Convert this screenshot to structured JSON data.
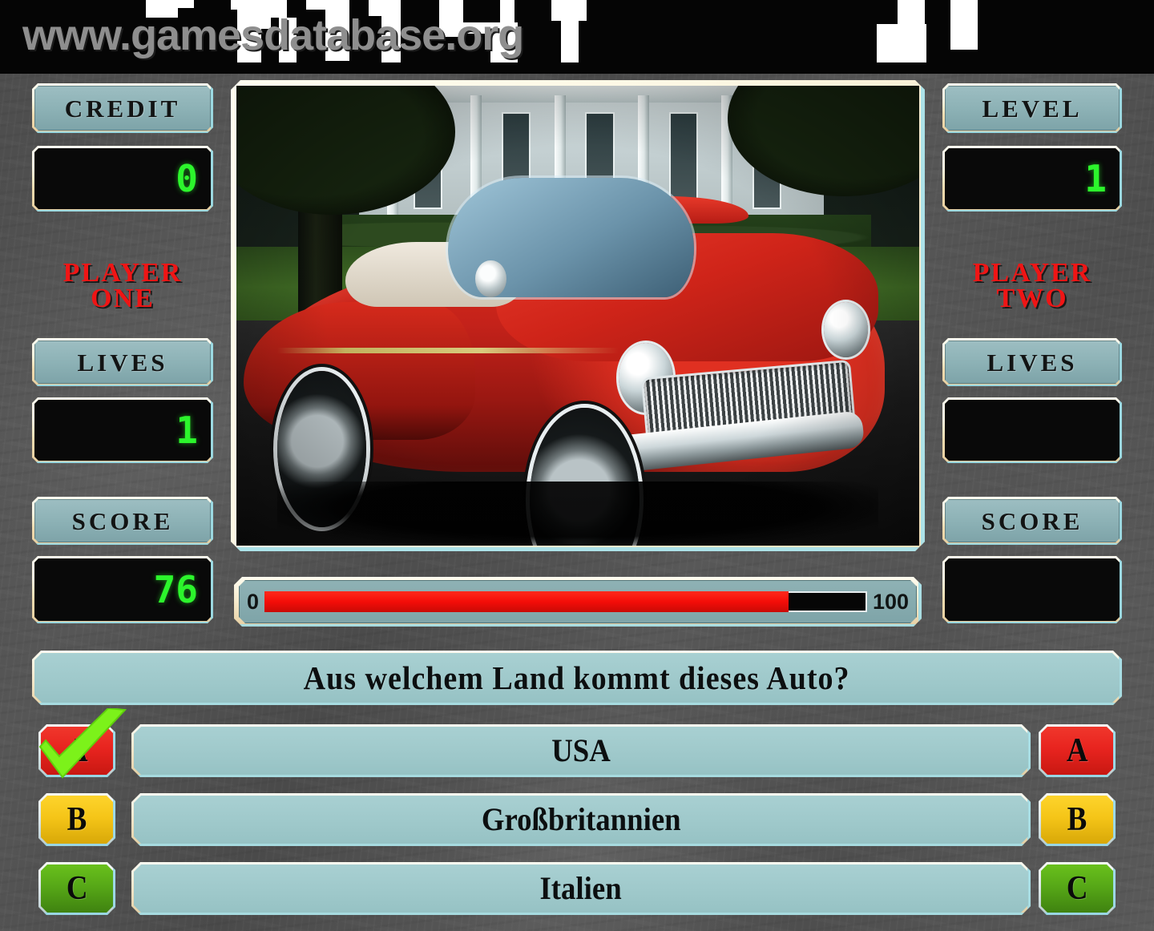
{
  "watermark": {
    "text": "www.gamesdatabase.org"
  },
  "colors": {
    "accent_red": "#ef1515",
    "lcd_green": "#2cf52c",
    "panel_teal": "#a8d0d2",
    "bevel_cream": "#fffdf0",
    "bevel_cyan": "#a8e0e9",
    "key_a": "#e8241f",
    "key_b": "#f5c518",
    "key_c": "#57a817",
    "timer_red": "#f40d08",
    "check_green": "#7cf21a",
    "background_gray": "#505050"
  },
  "left_panel": {
    "credit_label": "CREDIT",
    "credit_value": "0",
    "player_name_line1": "PLAYER",
    "player_name_line2": "ONE",
    "lives_label": "LIVES",
    "lives_value": "1",
    "score_label": "SCORE",
    "score_value": "76"
  },
  "right_panel": {
    "level_label": "LEVEL",
    "level_value": "1",
    "player_name_line1": "PLAYER",
    "player_name_line2": "TWO",
    "lives_label": "LIVES",
    "lives_value": "",
    "score_label": "SCORE",
    "score_value": ""
  },
  "photo": {
    "description": "red 1950s American convertible car parked on driveway in front of white house"
  },
  "timer": {
    "min_label": "0",
    "max_label": "100",
    "value": 87,
    "fill_percent": "87%"
  },
  "question": {
    "text": "Aus welchem Land kommt dieses Auto?"
  },
  "answers": [
    {
      "key": "A",
      "text": "USA",
      "color": "#e8241f",
      "correct": true
    },
    {
      "key": "B",
      "text": "Großbritannien",
      "color": "#f5c518",
      "correct": false
    },
    {
      "key": "C",
      "text": "Italien",
      "color": "#57a817",
      "correct": false
    }
  ]
}
